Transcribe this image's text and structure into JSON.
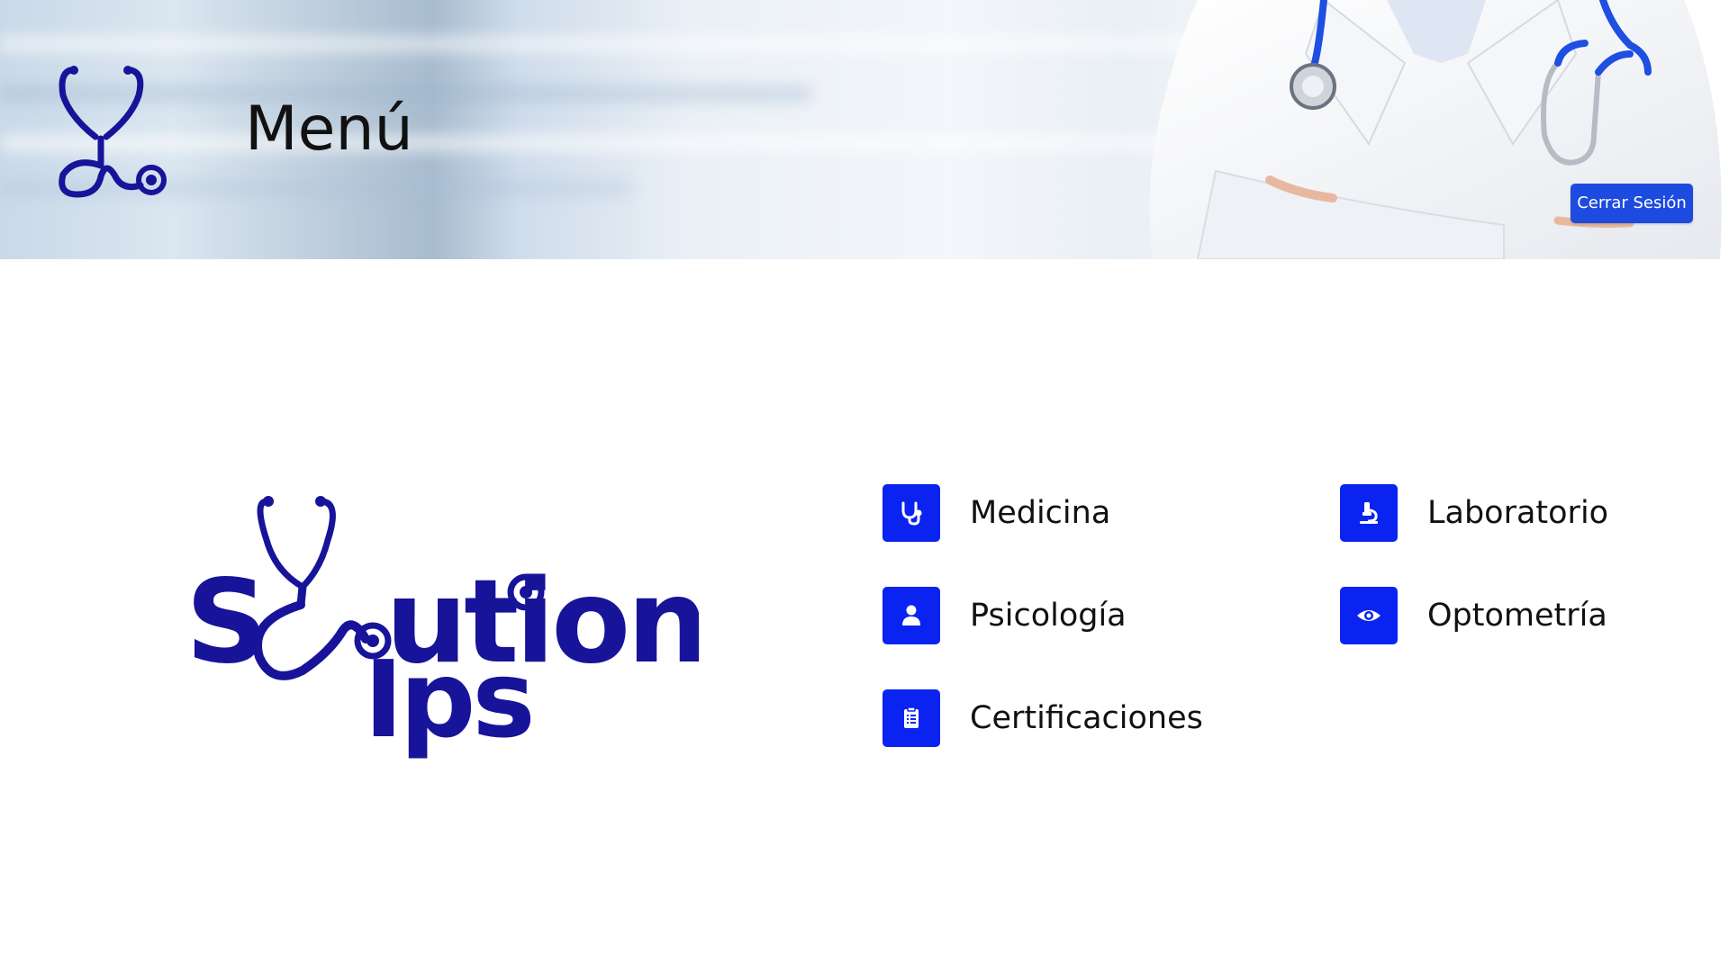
{
  "header": {
    "title": "Menú",
    "logout_label": "Cerrar Sesión",
    "logo_icon": "stethoscope-icon"
  },
  "brand": {
    "name": "Solution Ips",
    "color": "#17149a"
  },
  "menu": {
    "items": [
      {
        "label": "Medicina",
        "icon": "stethoscope-icon"
      },
      {
        "label": "Laboratorio",
        "icon": "microscope-icon"
      },
      {
        "label": "Psicología",
        "icon": "user-icon"
      },
      {
        "label": "Optometría",
        "icon": "eye-icon"
      },
      {
        "label": "Certificaciones",
        "icon": "clipboard-list-icon"
      }
    ]
  },
  "colors": {
    "accent": "#0a23f0",
    "logout_button": "#1d4be0",
    "logo": "#17149a"
  }
}
